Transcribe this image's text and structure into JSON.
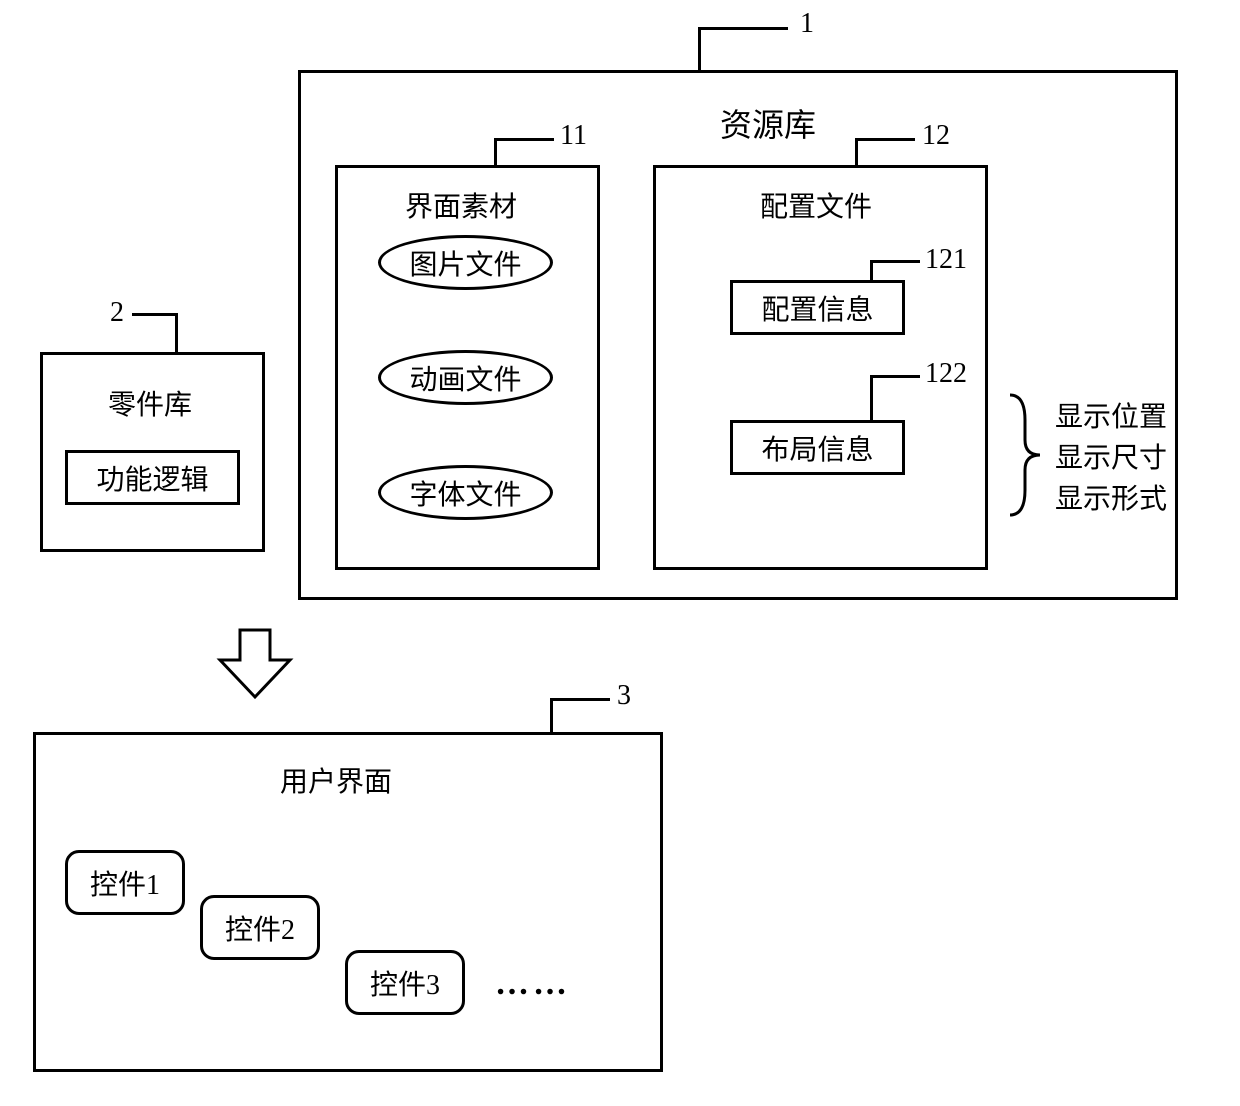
{
  "resource_lib": {
    "num": "1",
    "title": "资源库",
    "materials": {
      "num": "11",
      "title": "界面素材",
      "items": [
        "图片文件",
        "动画文件",
        "字体文件"
      ]
    },
    "config": {
      "num": "12",
      "title": "配置文件",
      "config_info": {
        "num": "121",
        "label": "配置信息"
      },
      "layout_info": {
        "num": "122",
        "label": "布局信息",
        "details": [
          "显示位置",
          "显示尺寸",
          "显示形式"
        ]
      }
    }
  },
  "parts_lib": {
    "num": "2",
    "title": "零件库",
    "logic": "功能逻辑"
  },
  "ui": {
    "num": "3",
    "title": "用户界面",
    "controls": [
      "控件1",
      "控件2",
      "控件3"
    ],
    "more": "……"
  }
}
